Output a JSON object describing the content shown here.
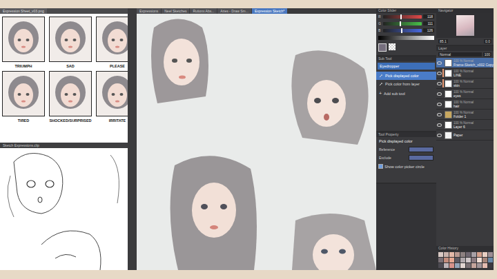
{
  "reference_window": {
    "tab": "Expression Sheet_v03.png",
    "cells": [
      {
        "label": "TRIUMPH"
      },
      {
        "label": "SAD"
      },
      {
        "label": "PLEASE"
      },
      {
        "label": "TIRED"
      },
      {
        "label": "SHOCKED/SURPRISED"
      },
      {
        "label": "IRRITATE"
      }
    ]
  },
  "sketch_window": {
    "title": "Sketch Expressions.clip"
  },
  "canvas_tabs": [
    {
      "label": "Expressions",
      "selected": false
    },
    {
      "label": "Neel Sketches",
      "selected": false
    },
    {
      "label": "Rutionx Abs...",
      "selected": false
    },
    {
      "label": "Aries - Draw Sm...",
      "selected": false
    },
    {
      "label": "Expression Sketch*",
      "selected": true
    }
  ],
  "color_slider": {
    "title": "Color Slider",
    "sliders": [
      {
        "channel": "R",
        "value": "118",
        "level": 0.46,
        "color": "#e04848"
      },
      {
        "channel": "G",
        "value": "111",
        "level": 0.44,
        "color": "#48c048"
      },
      {
        "channel": "B",
        "value": "126",
        "level": 0.49,
        "color": "#4868e0"
      }
    ]
  },
  "sub_tool": {
    "title": "Sub Tool",
    "group": "Eyedropper",
    "items": [
      {
        "label": "Pick displayed color",
        "selected": true
      },
      {
        "label": "Pick color from layer",
        "selected": false
      }
    ],
    "add_label": "Add sub tool",
    "add_icon": "+"
  },
  "tool_property": {
    "title": "Tool Property",
    "tool": "Pick displayed color",
    "fields": [
      {
        "label": "Reference"
      },
      {
        "label": "Exclude"
      }
    ],
    "checkbox": {
      "label": "Show color picker circle",
      "checked": true
    }
  },
  "navigator": {
    "title": "Navigator",
    "zoom": "85.1",
    "angle": "0.0"
  },
  "layer_panel": {
    "title": "Layer",
    "mode": "Normal",
    "opacity": "100",
    "layers": [
      {
        "kind": "layer",
        "blend": "100 % Normal",
        "name": "Frame-Sketch_v002 Copy",
        "selected": true,
        "visible": true
      },
      {
        "kind": "layer",
        "blend": "100 % Normal",
        "name": "LINE",
        "selected": false,
        "visible": true,
        "color": "#e89a74"
      },
      {
        "kind": "layer",
        "blend": "100 % Normal",
        "name": "skin",
        "selected": false,
        "visible": true,
        "color": "#e89a74"
      },
      {
        "kind": "layer",
        "blend": "100 % Normal",
        "name": "eyes",
        "selected": false,
        "visible": true
      },
      {
        "kind": "layer",
        "blend": "100 % Normal",
        "name": "hair",
        "selected": false,
        "visible": true
      },
      {
        "kind": "folder",
        "blend": "100 % Normal",
        "name": "Folder 1",
        "selected": false,
        "visible": true
      },
      {
        "kind": "layer",
        "blend": "100 % Normal",
        "name": "Layer 6",
        "selected": false,
        "visible": true
      },
      {
        "kind": "paper",
        "blend": "",
        "name": "Paper",
        "selected": false,
        "visible": true
      }
    ]
  },
  "color_history": {
    "title": "Color History",
    "swatches": [
      {
        "color": "#d9c9c4"
      },
      {
        "color": "#c9b3ad"
      },
      {
        "color": "#e3b8a8"
      },
      {
        "color": "#b89890"
      },
      {
        "color": "#8c8080"
      },
      {
        "color": "#6e6670"
      },
      {
        "color": "#a7a0a6"
      },
      {
        "color": "#d4a08c"
      },
      {
        "color": "#e8cfc3"
      },
      {
        "color": "#9c8e94"
      },
      {
        "color": "#7a7076"
      },
      {
        "color": "#c38c7c"
      },
      {
        "color": "#e6a892"
      },
      {
        "color": "#5c5860"
      },
      {
        "color": "#b0a8ac"
      },
      {
        "color": "#cfc6c8"
      },
      {
        "color": "#8a7a80"
      },
      {
        "color": "#f0ddd4"
      },
      {
        "color": "#a48478"
      },
      {
        "color": "#6a8aa8"
      },
      {
        "color": "#4c4a52"
      },
      {
        "color": "#bdb4b8"
      },
      {
        "color": "#d8928a"
      },
      {
        "color": "#94a4b8"
      },
      {
        "color": "#e2d6d2"
      },
      {
        "color": "#786e72"
      },
      {
        "color": "#c4a49c"
      },
      {
        "color": "#a09498"
      },
      {
        "color": "#e4bcb0"
      },
      {
        "color": "#3c3a40"
      }
    ]
  }
}
